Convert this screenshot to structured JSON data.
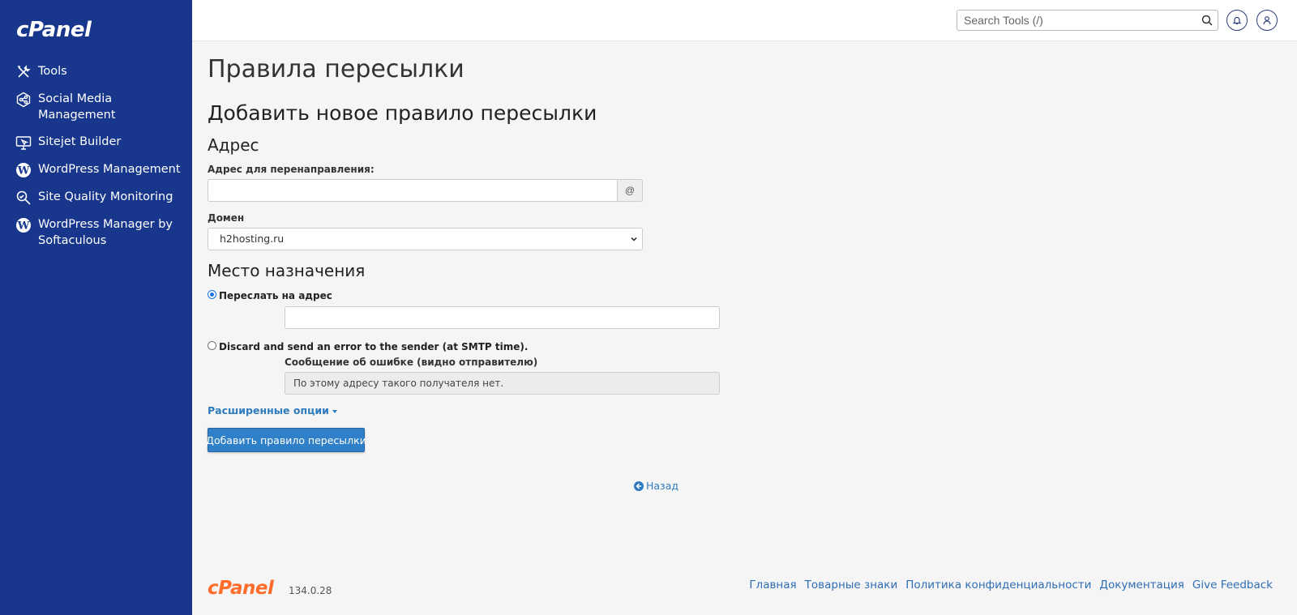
{
  "sidebar": {
    "logo": "cPanel",
    "items": [
      {
        "label": "Tools",
        "icon": "tools-icon"
      },
      {
        "label": "Social Media Management",
        "icon": "social-media-icon"
      },
      {
        "label": "Sitejet Builder",
        "icon": "sitejet-icon"
      },
      {
        "label": "WordPress Management",
        "icon": "wordpress-icon"
      },
      {
        "label": "Site Quality Monitoring",
        "icon": "magnifier-icon"
      },
      {
        "label": "WordPress Manager by Softaculous",
        "icon": "wordpress-icon"
      }
    ]
  },
  "topbar": {
    "search_placeholder": "Search Tools (/)"
  },
  "main": {
    "page_title": "Правила пересылки",
    "subtitle": "Добавить новое правило пересылки",
    "address_section": "Адрес",
    "address_label": "Адрес для перенаправления:",
    "address_value": "",
    "at_sign": "@",
    "domain_label": "Домен",
    "domain_selected": "h2hosting.ru",
    "destination_section": "Место назначения",
    "forward_label": "Переслать на адрес",
    "forward_value": "",
    "discard_label": "Discard and send an error to the sender (at SMTP time).",
    "error_message_label": "Сообщение об ошибке (видно отправителю)",
    "error_message_value": "По этому адресу такого получателя нет.",
    "advanced_options": "Расширенные опции",
    "submit_button": "Добавить правило пересылки",
    "back_link": "Назад"
  },
  "footer": {
    "logo": "cPanel",
    "version": "134.0.28",
    "links": [
      "Главная",
      "Товарные знаки",
      "Политика конфиденциальности",
      "Документация",
      "Give Feedback"
    ]
  },
  "colors": {
    "sidebar_bg": "#17368c",
    "accent": "#2f80c8",
    "link": "#2f7bbf",
    "footer_logo": "#ff6c2c"
  }
}
